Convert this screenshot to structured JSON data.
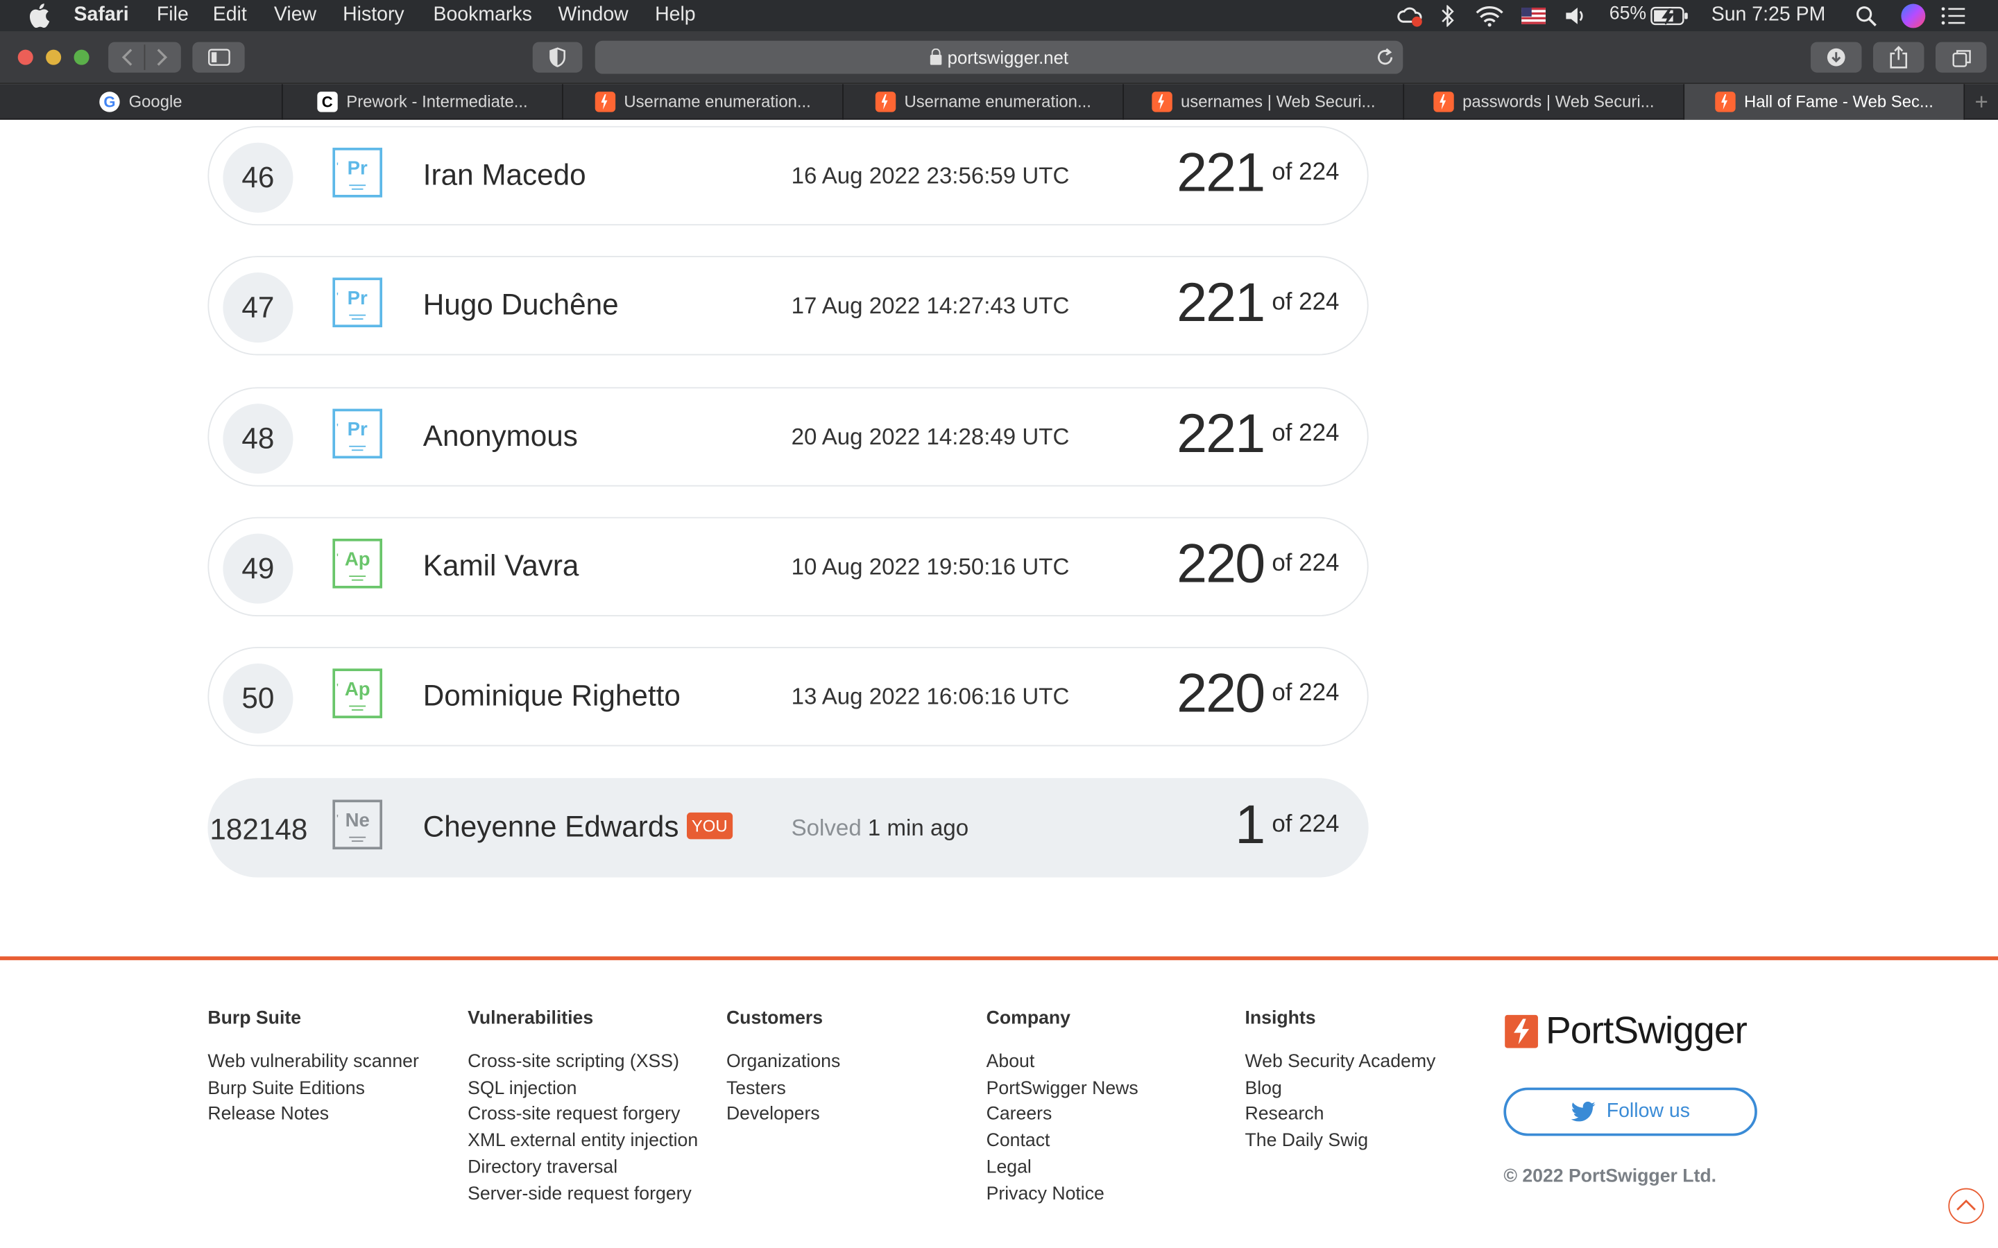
{
  "menubar": {
    "app": "Safari",
    "items": [
      "File",
      "Edit",
      "View",
      "History",
      "Bookmarks",
      "Window",
      "Help"
    ],
    "battery": "65%",
    "clock": "Sun 7:25 PM"
  },
  "browser": {
    "url": "portswigger.net",
    "tabs": [
      {
        "label": "Google",
        "favicon": "google-icon"
      },
      {
        "label": "Prework - Intermediate...",
        "favicon": "codepath-icon"
      },
      {
        "label": "Username enumeration...",
        "favicon": "portswigger-icon"
      },
      {
        "label": "Username enumeration...",
        "favicon": "portswigger-icon"
      },
      {
        "label": "usernames | Web Securi...",
        "favicon": "portswigger-icon"
      },
      {
        "label": "passwords | Web Securi...",
        "favicon": "portswigger-icon"
      },
      {
        "label": "Hall of Fame - Web Sec...",
        "favicon": "portswigger-icon",
        "active": true
      }
    ]
  },
  "leaderboard": {
    "rows": [
      {
        "rank": "46",
        "level": "Pr",
        "name": "Iran Macedo",
        "date": "16 Aug 2022 23:56:59 UTC",
        "score": "221",
        "total": "of 224"
      },
      {
        "rank": "47",
        "level": "Pr",
        "name": "Hugo Duchêne",
        "date": "17 Aug 2022 14:27:43 UTC",
        "score": "221",
        "total": "of 224"
      },
      {
        "rank": "48",
        "level": "Pr",
        "name": "Anonymous",
        "date": "20 Aug 2022 14:28:49 UTC",
        "score": "221",
        "total": "of 224"
      },
      {
        "rank": "49",
        "level": "Ap",
        "name": "Kamil Vavra",
        "date": "10 Aug 2022 19:50:16 UTC",
        "score": "220",
        "total": "of 224"
      },
      {
        "rank": "50",
        "level": "Ap",
        "name": "Dominique Righetto",
        "date": "13 Aug 2022 16:06:16 UTC",
        "score": "220",
        "total": "of 224"
      }
    ],
    "me": {
      "rank": "182148",
      "level": "Ne",
      "name": "Cheyenne Edwards",
      "you_badge": "YOU",
      "solved_label": "Solved",
      "solved_time": "1 min ago",
      "score": "1",
      "total": "of 224"
    }
  },
  "footer": {
    "columns": [
      {
        "heading": "Burp Suite",
        "links": [
          "Web vulnerability scanner",
          "Burp Suite Editions",
          "Release Notes"
        ]
      },
      {
        "heading": "Vulnerabilities",
        "links": [
          "Cross-site scripting (XSS)",
          "SQL injection",
          "Cross-site request forgery",
          "XML external entity injection",
          "Directory traversal",
          "Server-side request forgery"
        ]
      },
      {
        "heading": "Customers",
        "links": [
          "Organizations",
          "Testers",
          "Developers"
        ]
      },
      {
        "heading": "Company",
        "links": [
          "About",
          "PortSwigger News",
          "Careers",
          "Contact",
          "Legal",
          "Privacy Notice"
        ]
      },
      {
        "heading": "Insights",
        "links": [
          "Web Security Academy",
          "Blog",
          "Research",
          "The Daily Swig"
        ]
      }
    ],
    "brand": "PortSwigger",
    "follow_label": "Follow us",
    "copyright": "© 2022 PortSwigger Ltd."
  },
  "colors": {
    "accent": "#e85d33",
    "practitioner": "#5db8e8",
    "apprentice": "#69c56a",
    "newcomer": "#8a8f94",
    "link_blue": "#3a8bd6"
  }
}
